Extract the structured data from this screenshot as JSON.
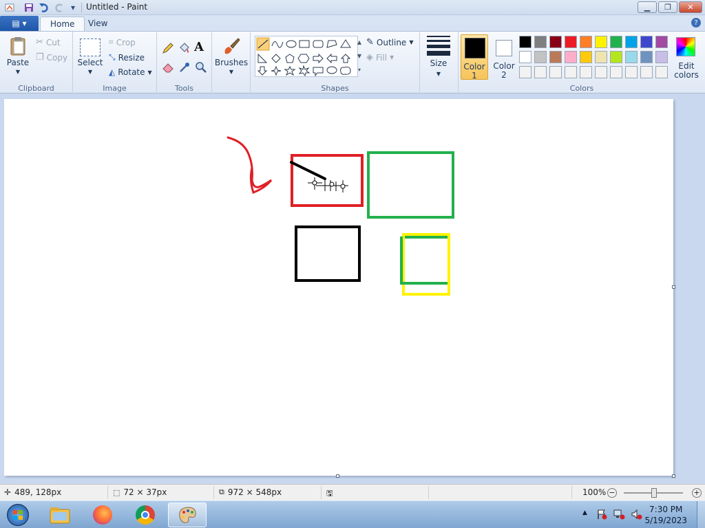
{
  "window": {
    "title": "Untitled - Paint",
    "controls": {
      "minimize": "▁",
      "restore": "❐",
      "close": "✕"
    }
  },
  "quick_access": {
    "dropdown": "▾"
  },
  "tabs": {
    "app_menu": "▤ ▾",
    "home": "Home",
    "view": "View",
    "help": "?"
  },
  "clipboard": {
    "paste": "Paste",
    "cut": "Cut",
    "copy": "Copy",
    "label": "Clipboard"
  },
  "image": {
    "select": "Select",
    "crop": "Crop",
    "resize": "Resize",
    "rotate": "Rotate",
    "label": "Image"
  },
  "tools": {
    "label": "Tools",
    "text_tool": "A"
  },
  "brushes": {
    "label": "Brushes"
  },
  "shapes": {
    "outline": "Outline",
    "fill": "Fill",
    "label": "Shapes"
  },
  "size": {
    "label": "Size"
  },
  "colors": {
    "color1": "Color 1",
    "color2": "Color 2",
    "edit": "Edit colors",
    "label": "Colors",
    "color1_value": "#000000",
    "color2_value": "#ffffff",
    "palette_row1": [
      "#000000",
      "#7f7f7f",
      "#880015",
      "#ed1c24",
      "#ff7f27",
      "#fff200",
      "#22b14c",
      "#00a2e8",
      "#3f48cc",
      "#a349a4"
    ],
    "palette_row2": [
      "#ffffff",
      "#c3c3c3",
      "#b97a57",
      "#ffaec9",
      "#ffc90e",
      "#efe4b0",
      "#b5e61d",
      "#99d9ea",
      "#7092be",
      "#c8bfe7"
    ],
    "palette_row3": [
      "#f2f2f2",
      "#f2f2f2",
      "#f2f2f2",
      "#f2f2f2",
      "#f2f2f2",
      "#f2f2f2",
      "#f2f2f2",
      "#f2f2f2",
      "#f2f2f2",
      "#f2f2f2"
    ]
  },
  "drawing": {
    "stroke_colors": {
      "red": "#e01f26",
      "green": "#22b14c",
      "black": "#000000",
      "yellow": "#fff200"
    }
  },
  "status": {
    "cursor_pos": "489, 128px",
    "selection_size": "72 × 37px",
    "canvas_size": "972 × 548px",
    "zoom": "100%"
  },
  "taskbar": {
    "time": "7:30 PM",
    "date": "5/19/2023",
    "tray_arrow": "▲"
  }
}
